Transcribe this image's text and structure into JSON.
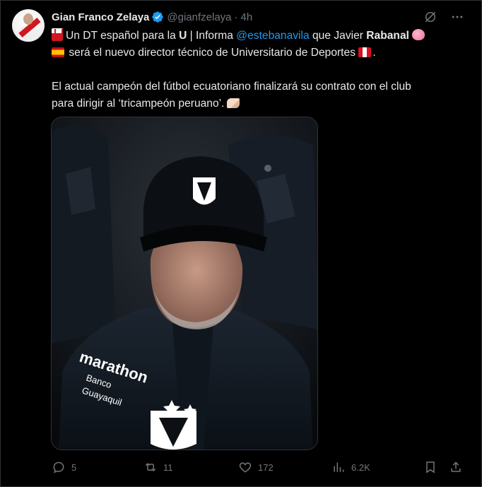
{
  "author": {
    "display_name": "Gian Franco Zelaya",
    "handle": "@gianfzelaya",
    "separator": "·",
    "time": "4h",
    "avatar_icon": "avatar-image"
  },
  "tweet": {
    "line1_a": "Un DT español para la ",
    "line1_b": "U",
    "line1_c": " | Informa ",
    "line1_mention": "@estebanavila",
    "line1_d": " que Javier ",
    "line1_name": "Rabanal",
    "line2": "será el nuevo director técnico de Universitario de Deportes",
    "line2_end": ".",
    "line3": "El actual campeón del fútbol ecuatoriano finalizará su contrato con el club",
    "line4": "para dirigir al ‘tricampeón peruano’."
  },
  "media": {
    "jacket_text_1": "marathon",
    "jacket_text_2": "Banco",
    "jacket_text_3": "Guayaquil"
  },
  "actions": {
    "replies": "5",
    "reposts": "11",
    "likes": "172",
    "views": "6.2K"
  },
  "colors": {
    "background": "#000000",
    "text": "#e7e9ea",
    "muted": "#71767b",
    "accent": "#1d9bf0",
    "border": "#2f3336"
  }
}
